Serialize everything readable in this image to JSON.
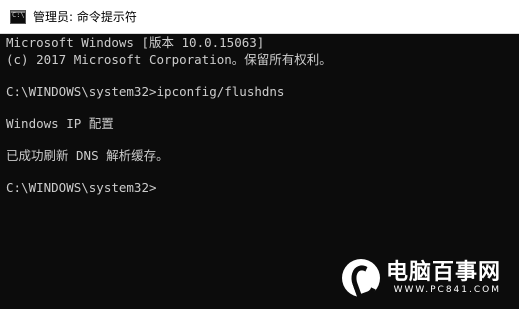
{
  "window": {
    "title": "管理员: 命令提示符",
    "icon": "console-icon"
  },
  "console": {
    "lines": [
      "Microsoft Windows [版本 10.0.15063]",
      "(c) 2017 Microsoft Corporation。保留所有权利。",
      "",
      "C:\\WINDOWS\\system32>ipconfig/flushdns",
      "",
      "Windows IP 配置",
      "",
      "已成功刷新 DNS 解析缓存。",
      "",
      "C:\\WINDOWS\\system32>"
    ]
  },
  "watermark": {
    "brand": "电脑百事网",
    "url": "WWW.PC841.COM"
  }
}
